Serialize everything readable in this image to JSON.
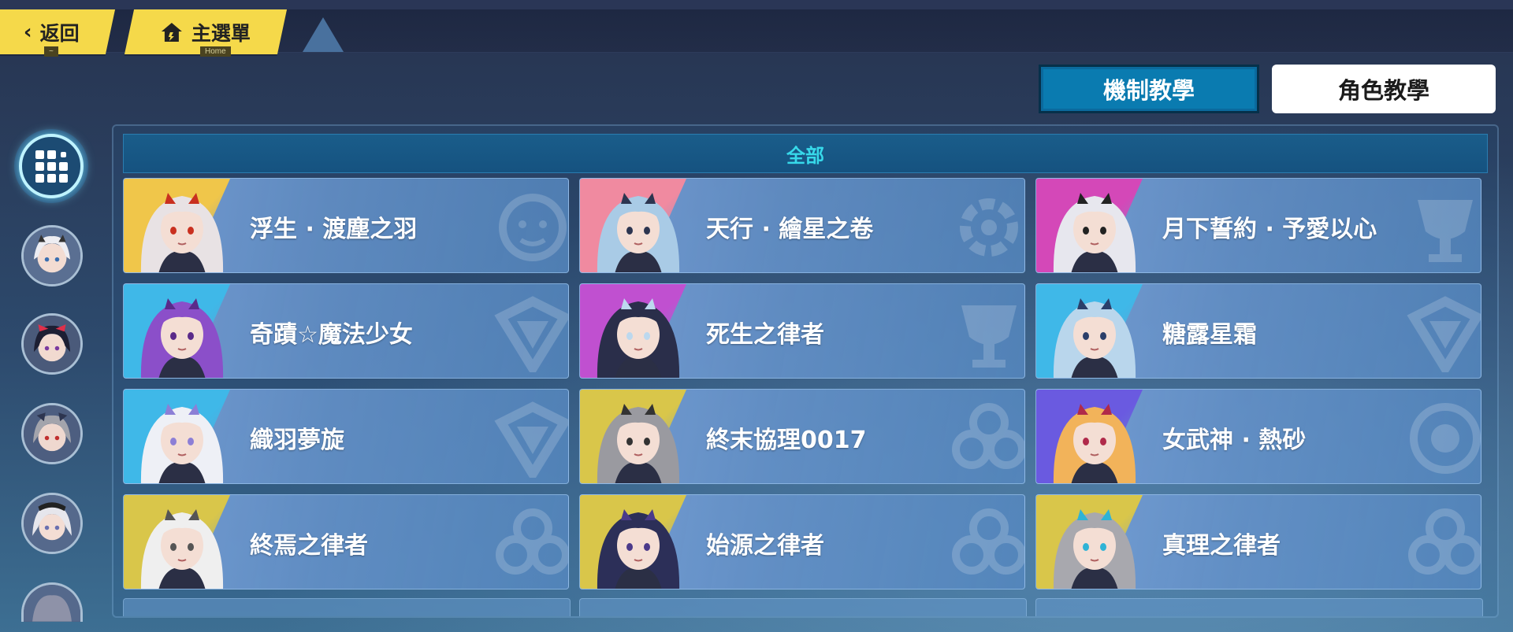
{
  "nav": {
    "back_label": "返回",
    "back_sub": "~",
    "home_label": "主選單",
    "home_sub": "Home"
  },
  "tabs": {
    "mechanics_label": "機制教學",
    "character_label": "角色教學",
    "active": "mechanics"
  },
  "filter": {
    "all_label": "全部"
  },
  "sidebar": {
    "grid_icon": "grid-icon",
    "avatars": [
      "avatar-1",
      "avatar-2",
      "avatar-3",
      "avatar-4",
      "avatar-5"
    ]
  },
  "characters": [
    {
      "name": "浮生 · 渡塵之羽",
      "accent": "#f0c64a",
      "hair": "#e8e2e4",
      "hair2": "#c9301f",
      "emblem": "face"
    },
    {
      "name": "天行 · 繪星之卷",
      "accent": "#f08aa0",
      "hair": "#a9cbe6",
      "hair2": "#2c3550",
      "emblem": "gear"
    },
    {
      "name": "月下誓約 · 予愛以心",
      "accent": "#d448b8",
      "hair": "#e7e7ee",
      "hair2": "#222",
      "emblem": "cup"
    },
    {
      "name": "奇蹟☆魔法少女",
      "accent": "#3fb8e8",
      "hair": "#8b4fc9",
      "hair2": "#5a2a8a",
      "emblem": "diamond"
    },
    {
      "name": "死生之律者",
      "accent": "#c050d0",
      "hair": "#2a2e4a",
      "hair2": "#bcd8ee",
      "emblem": "cup"
    },
    {
      "name": "糖露星霜",
      "accent": "#3fb8e8",
      "hair": "#b9d6ec",
      "hair2": "#2b3f6a",
      "emblem": "diamond"
    },
    {
      "name": "織羽夢旋",
      "accent": "#3fb8e8",
      "hair": "#eef0f6",
      "hair2": "#8c7fd6",
      "emblem": "diamond"
    },
    {
      "name": "終末協理0017",
      "accent": "#d9c64a",
      "hair": "#9a9aa0",
      "hair2": "#333",
      "emblem": "clover"
    },
    {
      "name": "女武神 · 熱砂",
      "accent": "#6a5ae0",
      "hair": "#f2b35a",
      "hair2": "#b02a4a",
      "emblem": "eye"
    },
    {
      "name": "終焉之律者",
      "accent": "#d9c64a",
      "hair": "#efefef",
      "hair2": "#555",
      "emblem": "clover"
    },
    {
      "name": "始源之律者",
      "accent": "#d9c64a",
      "hair": "#2c2f58",
      "hair2": "#4b3a8a",
      "emblem": "clover"
    },
    {
      "name": "真理之律者",
      "accent": "#d9c64a",
      "hair": "#a8a8ae",
      "hair2": "#2fb3d6",
      "emblem": "clover"
    }
  ]
}
